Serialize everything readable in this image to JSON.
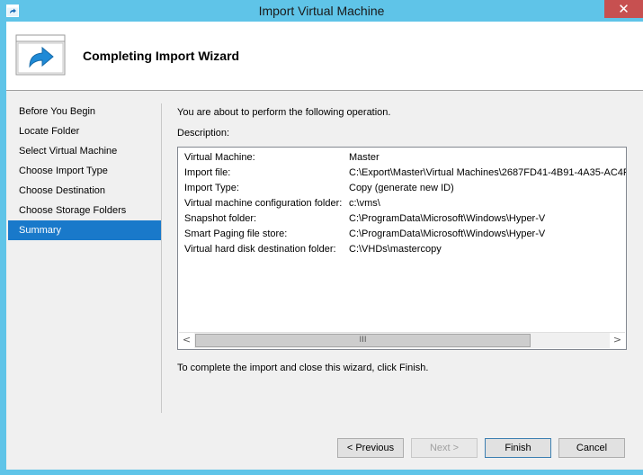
{
  "window": {
    "title": "Import Virtual Machine",
    "close_glyph": "✕",
    "accent": "#5fc4e8",
    "close_color": "#c75050"
  },
  "header": {
    "title": "Completing Import Wizard",
    "icon": "wizard-arrow-icon"
  },
  "nav": {
    "items": [
      {
        "label": "Before You Begin"
      },
      {
        "label": "Locate Folder"
      },
      {
        "label": "Select Virtual Machine"
      },
      {
        "label": "Choose Import Type"
      },
      {
        "label": "Choose Destination"
      },
      {
        "label": "Choose Storage Folders"
      },
      {
        "label": "Summary",
        "selected": true
      }
    ],
    "selected_color": "#1979ca"
  },
  "main": {
    "intro": "You are about to perform the following operation.",
    "description_label": "Description:",
    "details": [
      {
        "key": "Virtual Machine:",
        "value": "Master"
      },
      {
        "key": "Import file:",
        "value": "C:\\Export\\Master\\Virtual Machines\\2687FD41-4B91-4A35-AC4F"
      },
      {
        "key": "Import Type:",
        "value": "Copy (generate new ID)"
      },
      {
        "key": "Virtual machine configuration folder:",
        "value": "c:\\vms\\"
      },
      {
        "key": "Snapshot folder:",
        "value": "C:\\ProgramData\\Microsoft\\Windows\\Hyper-V"
      },
      {
        "key": "Smart Paging file store:",
        "value": "C:\\ProgramData\\Microsoft\\Windows\\Hyper-V"
      },
      {
        "key": "Virtual hard disk destination folder:",
        "value": "C:\\VHDs\\mastercopy"
      }
    ],
    "scrollbar": {
      "left_arrow": "<",
      "right_arrow": ">",
      "grip": "III"
    },
    "finish_note": "To complete the import and close this wizard, click Finish."
  },
  "buttons": {
    "previous": "< Previous",
    "next": "Next >",
    "finish": "Finish",
    "cancel": "Cancel"
  }
}
